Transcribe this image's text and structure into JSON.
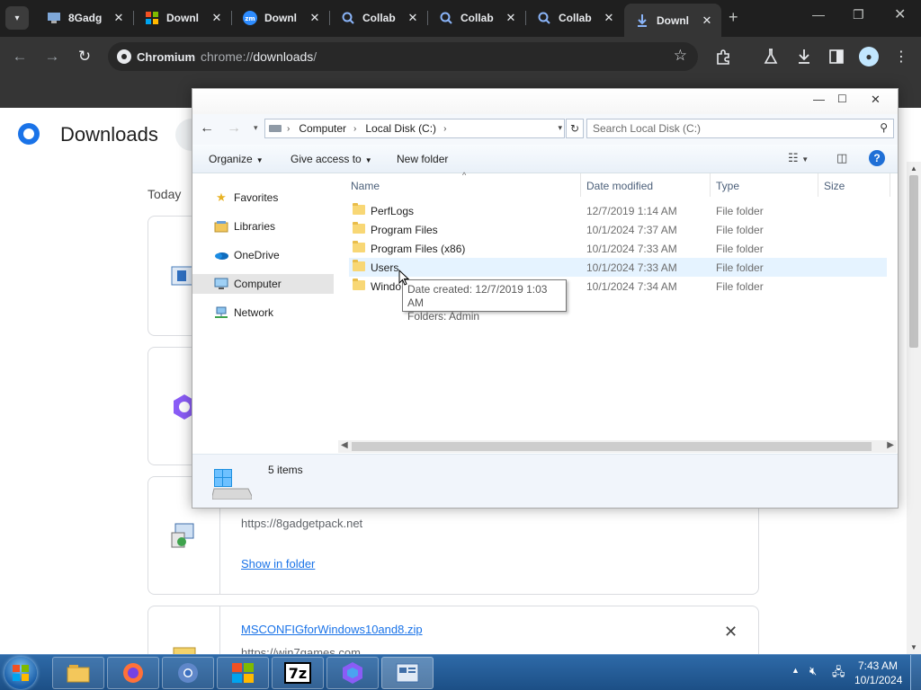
{
  "browser": {
    "tabs": [
      {
        "title": "8Gadg",
        "icon": "gadget-icon"
      },
      {
        "title": "Downl",
        "icon": "microsoft-icon"
      },
      {
        "title": "Downl",
        "icon": "zoom-icon"
      },
      {
        "title": "Collab",
        "icon": "search-icon"
      },
      {
        "title": "Collab",
        "icon": "search-icon"
      },
      {
        "title": "Collab",
        "icon": "search-icon"
      },
      {
        "title": "Downl",
        "icon": "download-icon",
        "active": true
      }
    ],
    "omnibox": {
      "chip": "Chromium",
      "url_prefix": "chrome://",
      "url_path": "downloads",
      "url_suffix": "/"
    }
  },
  "downloads_page": {
    "title": "Downloads",
    "section_today": "Today",
    "items": [
      {
        "source": "https://8gadgetpack.net",
        "action": "Show in folder"
      },
      {
        "filename": "MSCONFIGforWindows10and8.zip",
        "source": "https://win7games.com"
      }
    ]
  },
  "explorer": {
    "breadcrumb": [
      "Computer",
      "Local Disk (C:)"
    ],
    "search_placeholder": "Search Local Disk (C:)",
    "commands": {
      "organize": "Organize",
      "give_access": "Give access to",
      "new_folder": "New folder"
    },
    "nav": [
      {
        "label": "Favorites",
        "icon": "star-icon"
      },
      {
        "label": "Libraries",
        "icon": "libraries-icon"
      },
      {
        "label": "OneDrive",
        "icon": "cloud-icon"
      },
      {
        "label": "Computer",
        "icon": "computer-icon",
        "selected": true
      },
      {
        "label": "Network",
        "icon": "network-icon"
      }
    ],
    "columns": [
      "Name",
      "Date modified",
      "Type",
      "Size"
    ],
    "rows": [
      {
        "name": "PerfLogs",
        "date": "12/7/2019 1:14 AM",
        "type": "File folder"
      },
      {
        "name": "Program Files",
        "date": "10/1/2024 7:37 AM",
        "type": "File folder"
      },
      {
        "name": "Program Files (x86)",
        "date": "10/1/2024 7:33 AM",
        "type": "File folder"
      },
      {
        "name": "Users",
        "date": "10/1/2024 7:33 AM",
        "type": "File folder",
        "hover": true
      },
      {
        "name": "Windo",
        "date": "10/1/2024 7:34 AM",
        "type": "File folder"
      }
    ],
    "tooltip": {
      "line1": "Date created: 12/7/2019 1:03 AM",
      "line2": "Folders: Admin"
    },
    "status": "5 items"
  },
  "taskbar": {
    "apps": [
      "explorer-icon",
      "firefox-icon",
      "chromium-icon",
      "windows-icon",
      "7zip-icon",
      "copilot-icon",
      "control-panel-icon"
    ],
    "app_7zip_label": "7z",
    "clock_time": "7:43 AM",
    "clock_date": "10/1/2024"
  },
  "colors": {
    "chrome_dark": "#1f1f1f",
    "toolbar": "#353535",
    "link_blue": "#1a73e8",
    "taskbar_blue": "#1c4f86",
    "hover_row": "#e5f3ff"
  }
}
